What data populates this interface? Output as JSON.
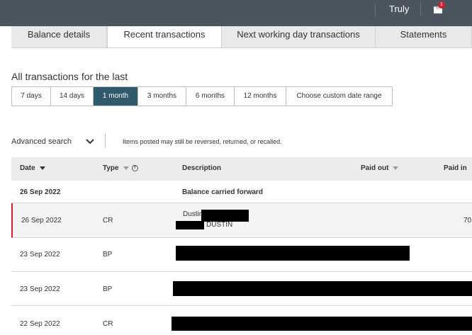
{
  "header": {
    "user_name": "Truly",
    "messages_count": "1"
  },
  "tabs": [
    {
      "label": "Balance details",
      "active": false
    },
    {
      "label": "Recent transactions",
      "active": true
    },
    {
      "label": "Next working day transactions",
      "active": false
    },
    {
      "label": "Statements",
      "active": false
    }
  ],
  "range": {
    "title": "All transactions for the last",
    "options": [
      "7 days",
      "14 days",
      "1 month",
      "3 months",
      "6 months",
      "12 months",
      "Choose custom date range"
    ],
    "selected": "1 month"
  },
  "advanced_search": {
    "label": "Advanced search",
    "note": "Items posted may still be reversed, returned, or recalled."
  },
  "table": {
    "columns": {
      "date": "Date",
      "type": "Type",
      "description": "Description",
      "paid_out": "Paid out",
      "paid_in": "Paid in"
    },
    "rows": [
      {
        "date": "26 Sep 2022",
        "type": "",
        "description": "Balance carried forward",
        "paid_in": ""
      },
      {
        "date": "26 Sep 2022",
        "type": "CR",
        "description": "Dustin",
        "description2": "DUSTIN",
        "paid_in": "70"
      },
      {
        "date": "23 Sep 2022",
        "type": "BP",
        "description": "",
        "paid_in": ""
      },
      {
        "date": "23 Sep 2022",
        "type": "BP",
        "description": "",
        "paid_in": ""
      },
      {
        "date": "22 Sep 2022",
        "type": "CR",
        "description": "",
        "paid_in": ""
      }
    ]
  },
  "colors": {
    "topbar": "#4b5560",
    "active_range": "#305a6b",
    "accent_red": "#d3202b"
  }
}
